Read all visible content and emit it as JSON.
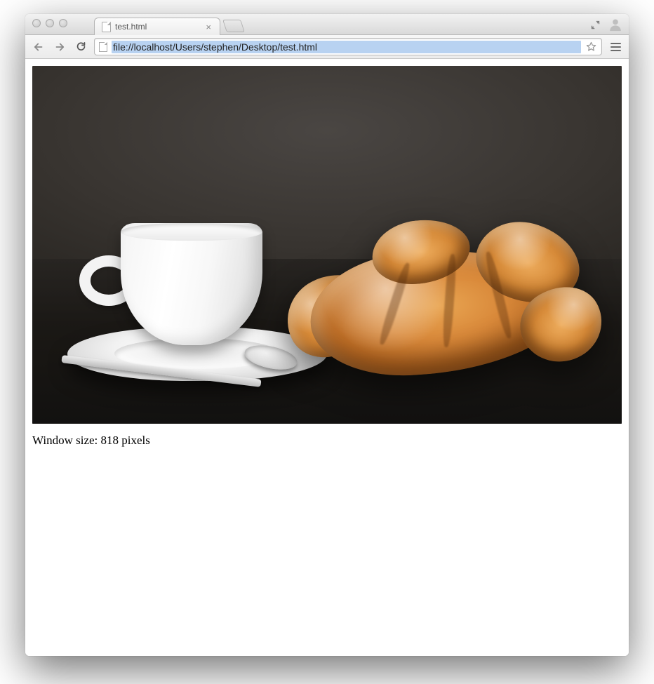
{
  "window": {
    "traffic_lights": [
      "close",
      "minimize",
      "zoom"
    ]
  },
  "tab": {
    "title": "test.html",
    "close_glyph": "×"
  },
  "toolbar": {
    "back_name": "back",
    "forward_name": "forward",
    "reload_name": "reload",
    "url": "file://localhost/Users/stephen/Desktop/test.html",
    "bookmark_name": "bookmark-star",
    "menu_name": "menu"
  },
  "titlebar_icons": {
    "fullscreen_name": "enter-fullscreen",
    "avatar_name": "profile-avatar"
  },
  "page": {
    "image_alt": "white espresso cup on saucer with spoon beside a croissant on dark background",
    "caption": "Window size: 818 pixels"
  }
}
